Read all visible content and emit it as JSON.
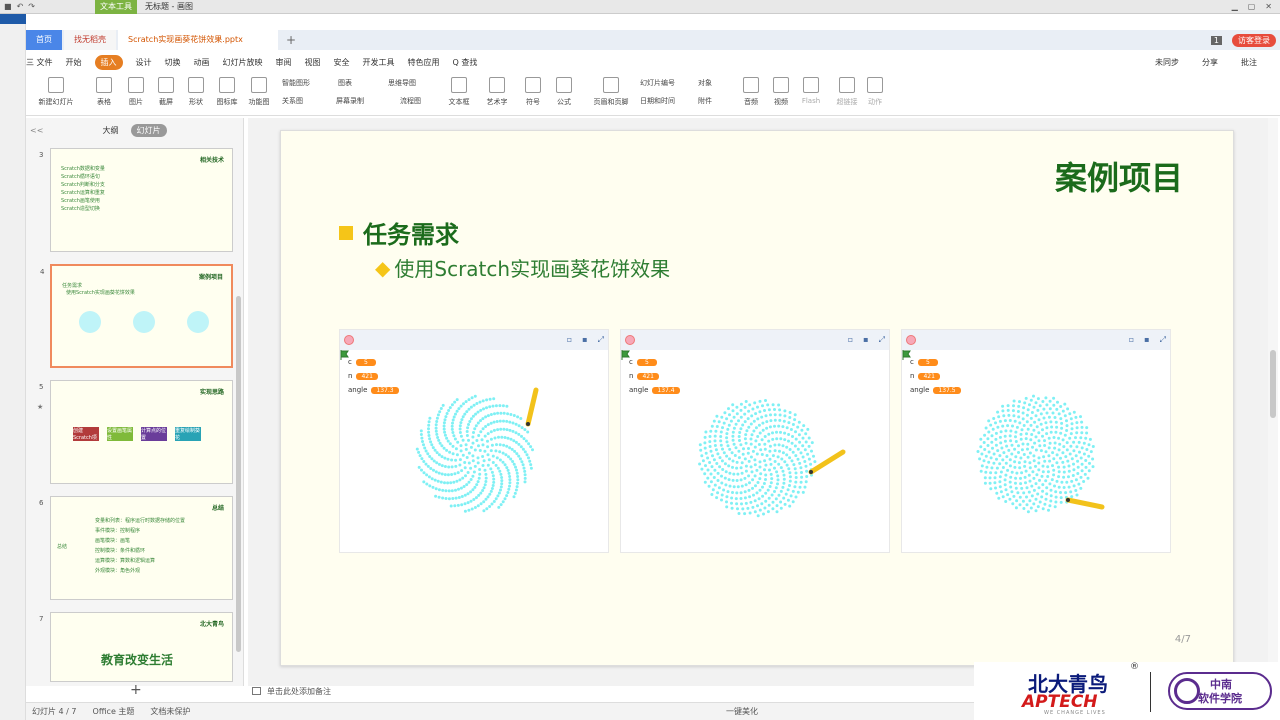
{
  "titlebar": {
    "context_tab": "文本工具",
    "doc_name": "无标题 - 画图"
  },
  "tabs": [
    {
      "label": "首页"
    },
    {
      "label": "找无稻壳"
    },
    {
      "label": "Scratch实现画葵花饼效果.pptx"
    }
  ],
  "tab_page_indicator": "1",
  "login_label": "访客登录",
  "menu": [
    "三 文件",
    "开始",
    "插入",
    "设计",
    "切换",
    "动画",
    "幻灯片放映",
    "审阅",
    "视图",
    "安全",
    "开发工具",
    "特色应用",
    "Q 查找"
  ],
  "menu_active_index": 2,
  "menu_right": [
    "未同步",
    "分享",
    "批注"
  ],
  "ribbon": {
    "big": [
      "新建幻灯片",
      "表格",
      "图片",
      "截屏",
      "形状",
      "图标库",
      "功能图",
      "文本框",
      "艺术字",
      "符号",
      "公式",
      "页眉和页脚",
      "音频",
      "视频",
      "Flash",
      "超链接",
      "动作"
    ],
    "small": [
      "智能图形",
      "图表",
      "屏幕录制",
      "流程图",
      "关系图",
      "思维导图",
      "幻灯片编号",
      "对象",
      "日期和时间",
      "附件"
    ]
  },
  "panel": {
    "tab_outline": "大纲",
    "tab_slides": "幻灯片",
    "collapse": "<<"
  },
  "thumbnails": [
    {
      "num": "3",
      "title": "相关技术",
      "lines": [
        "Scratch数据和变量",
        "Scratch循环语句",
        "Scratch判断和分支",
        "Scratch运算和重复",
        "Scratch画笔使用",
        "Scratch造型切换"
      ]
    },
    {
      "num": "4",
      "title": "案例项目",
      "lines": [
        "任务需求",
        "使用Scratch实现画葵花饼效果"
      ]
    },
    {
      "num": "5",
      "title": "实现思路",
      "lines": [
        "创建Scratch项目",
        "设置画笔属性",
        "计算点的位置",
        "重复绘制葵花"
      ]
    },
    {
      "num": "6",
      "title": "总结",
      "lines": [
        "总结",
        "变量和列表：程序运行时数据存储的位置",
        "事件模块：控制程序",
        "画笔模块：画笔",
        "控制模块：条件和循环",
        "运算模块：算数和逻辑运算",
        "外观模块：角色外观"
      ]
    },
    {
      "num": "7",
      "title": "北大青鸟",
      "lines": [
        "教育改变生活"
      ]
    }
  ],
  "slide": {
    "title": "案例项目",
    "task_title": "任务需求",
    "task_desc": "使用Scratch实现画葵花饼效果",
    "page": "4/7"
  },
  "stages": [
    {
      "vars": [
        {
          "name": "c",
          "value": "5"
        },
        {
          "name": "n",
          "value": "421"
        },
        {
          "name": "angle",
          "value": "137.3"
        }
      ]
    },
    {
      "vars": [
        {
          "name": "c",
          "value": "5"
        },
        {
          "name": "n",
          "value": "421"
        },
        {
          "name": "angle",
          "value": "137.4"
        }
      ]
    },
    {
      "vars": [
        {
          "name": "c",
          "value": "5"
        },
        {
          "name": "n",
          "value": "421"
        },
        {
          "name": "angle",
          "value": "137.5"
        }
      ]
    }
  ],
  "notes_placeholder": "单击此处添加备注",
  "status": {
    "slide": "幻灯片 4 / 7",
    "theme": "Office 主题",
    "protect": "文档未保护",
    "beautify": "一键美化"
  },
  "logo": {
    "cn": "北大青鸟",
    "en": "APTECH",
    "tag": "WE CHANGE LIVES",
    "school_line1": "中南",
    "school_line2": "软件学院"
  },
  "colors": {
    "accent": "#e67e22",
    "slide_green": "#1b6b1b",
    "bullet_yellow": "#f5c518",
    "dot_cyan": "#7ff0f4"
  }
}
